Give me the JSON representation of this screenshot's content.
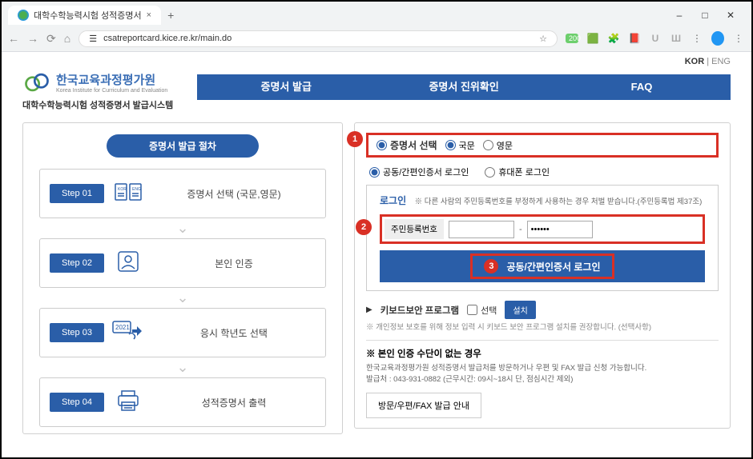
{
  "browser": {
    "tab_title": "대학수학능력시험 성적증명서",
    "url": "csatreportcard.kice.re.kr/main.do",
    "window_min": "–",
    "window_max": "□",
    "window_close": "✕"
  },
  "lang": {
    "kor": "KOR",
    "sep": "|",
    "eng": "ENG"
  },
  "logo": {
    "kor": "한국교육과정평가원",
    "eng": "Korea Institute for Curriculum and Evaluation",
    "subsystem": "대학수학능력시험 성적증명서 발급시스템"
  },
  "nav": {
    "issue": "증명서 발급",
    "verify": "증명서 진위확인",
    "faq": "FAQ"
  },
  "left": {
    "title": "증명서 발급 절차",
    "steps": [
      {
        "chip": "Step 01",
        "label": "증명서 선택 (국문,영문)"
      },
      {
        "chip": "Step 02",
        "label": "본인 인증"
      },
      {
        "chip": "Step 03",
        "label": "응시 학년도 선택"
      },
      {
        "chip": "Step 04",
        "label": "성적증명서 출력"
      }
    ],
    "year": "2021",
    "koreng": {
      "k": "KOR",
      "e": "ENG"
    }
  },
  "right": {
    "select_title": "증명서 선택",
    "opt_kor": "국문",
    "opt_eng": "영문",
    "method_cert": "공동/간편인증서 로그인",
    "method_phone": "휴대폰 로그인",
    "login_title": "로그인",
    "login_note": "※ 다른 사람의 주민등록번호를 부정하게 사용하는 경우 처벌 받습니다.(주민등록법 제37조)",
    "rrn_label": "주민등록번호",
    "rrn_dash": "-",
    "rrn_mask": "••••••",
    "login_btn": "공동/간편인증서 로그인",
    "kb_title": "키보드보안 프로그램",
    "kb_opt": "선택",
    "install": "설치",
    "kb_note": "※ 개인정보 보호를 위해 정보 입력 시 키보드 보안 프로그램 설치를 권장합니다. (선택사항)",
    "no_auth_title": "※ 본인 인증 수단이 없는 경우",
    "no_auth_note1": "한국교육과정평가원 성적증명서 발급처를 방문하거나 우편 및 FAX 발급 신청 가능합니다.",
    "no_auth_note2": "발급처 : 043-931-0882 (근무시간: 09시~18시 단, 점심시간 제외)",
    "visit_btn": "방문/우편/FAX 발급 안내"
  },
  "callouts": {
    "c1": "1",
    "c2": "2",
    "c3": "3"
  }
}
